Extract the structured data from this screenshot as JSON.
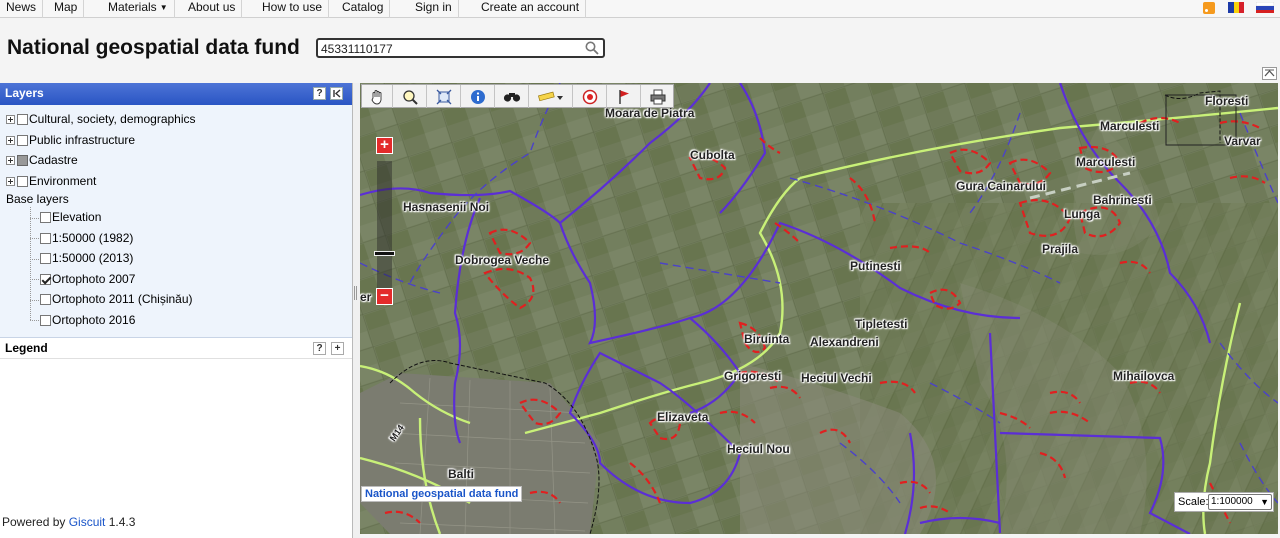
{
  "nav": {
    "items": [
      "News",
      "Map",
      "Materials",
      "About us",
      "How to use",
      "Catalog",
      "Sign in",
      "Create an account"
    ],
    "rss_icon": "rss-icon",
    "flags": [
      "flag-ro-icon",
      "flag-ru-icon"
    ]
  },
  "header": {
    "title": "National geospatial data fund",
    "search_value": "45331110177"
  },
  "layers_panel": {
    "title": "Layers",
    "help": "?",
    "collapse": "K",
    "groups": [
      "Cultural, society, demographics",
      "Public infrastructure",
      "Cadastre",
      "Environment"
    ],
    "base_title": "Base layers",
    "base_layers": [
      "Elevation",
      "1:50000 (1982)",
      "1:50000 (2013)",
      "Ortophoto 2007",
      "Ortophoto 2011 (Chișinău)",
      "Ortophoto 2016"
    ],
    "checked_base": "Ortophoto 2007"
  },
  "legend_panel": {
    "title": "Legend",
    "help": "?",
    "expand": "+"
  },
  "footer": {
    "powered_prefix": "Powered by ",
    "brand": "Giscuit",
    "version": " 1.4.3"
  },
  "map": {
    "zoom_in": "+",
    "zoom_out": "−",
    "edge_label": "er",
    "places": [
      "Moara de Piatra",
      "Floresti",
      "Marculesti",
      "Varvar",
      "Cubolta",
      "Marculesti",
      "Gura Cainarului",
      "Bahrinesti",
      "Lunga",
      "Hasnasenii Noi",
      "Prajila",
      "Dobrogea Veche",
      "Putinesti",
      "Tipletesti",
      "Biruinta",
      "Alexandreni",
      "Grigoresti",
      "Heciul Vechi",
      "Mihailovca",
      "Elizaveta",
      "Heciul Nou",
      "Balti"
    ],
    "road_label": "M14",
    "attribution": "National geospatial data fund",
    "scale_label": "Scale:",
    "scale_value": "1:100000",
    "tools": [
      "pan-hand-icon",
      "zoom-magnifier-icon",
      "full-extent-icon",
      "info-icon",
      "binoculars-search-icon",
      "measure-ruler-icon",
      "record-icon",
      "flag-icon",
      "print-icon"
    ],
    "colors": {
      "boundary": "#5b2ed6",
      "road": "#c8f078",
      "parcel": "#e02020",
      "dashed_boundary": "#4b42c8"
    }
  }
}
